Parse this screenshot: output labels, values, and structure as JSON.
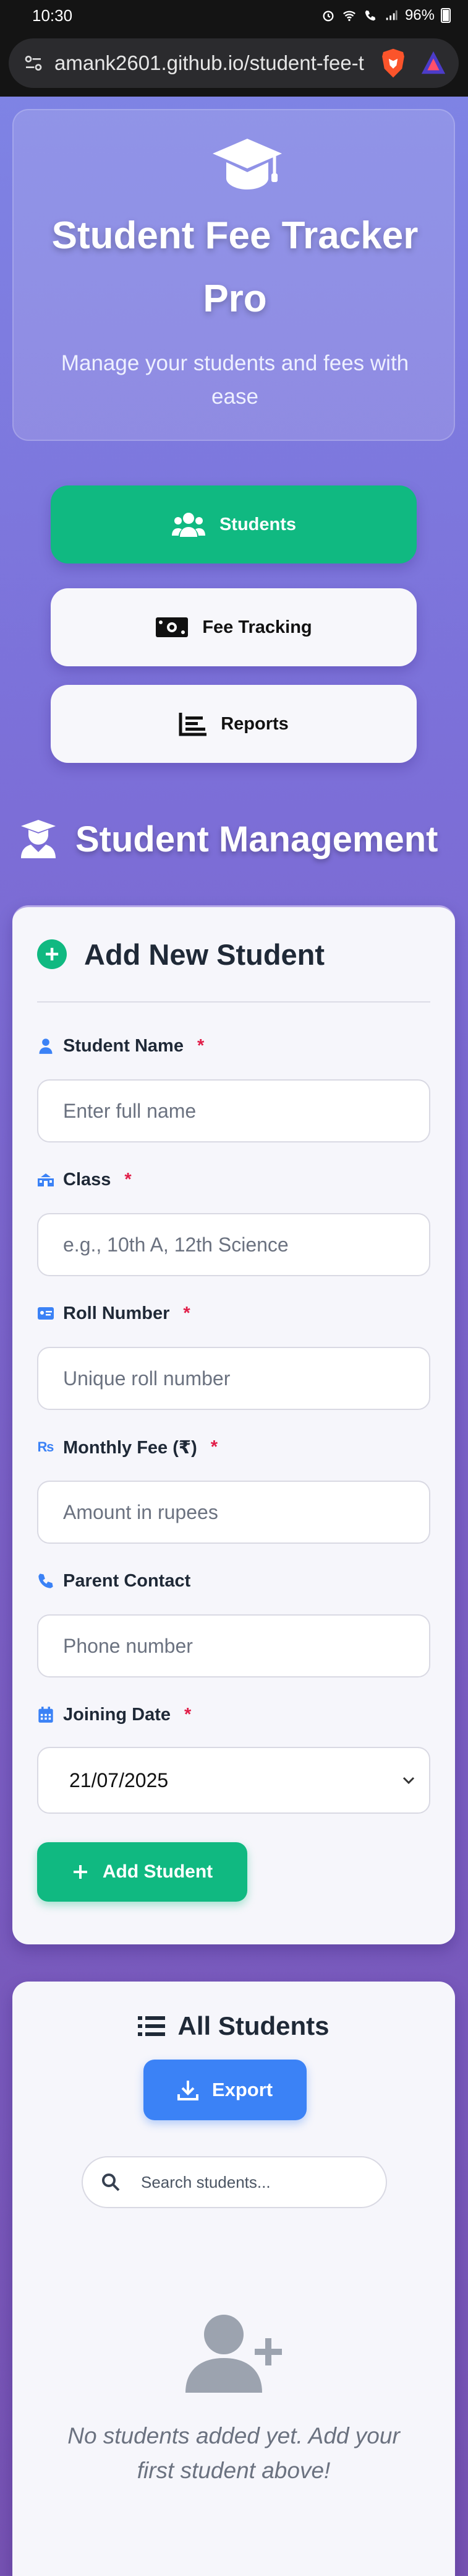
{
  "status_bar": {
    "time": "10:30",
    "battery": "96%"
  },
  "browser": {
    "url": "amank2601.github.io/student-fee-t"
  },
  "hero": {
    "title": "Student Fee Tracker Pro",
    "subtitle": "Manage your students and fees with ease"
  },
  "nav": [
    {
      "label": "Students",
      "icon": "users-icon",
      "active": true
    },
    {
      "label": "Fee Tracking",
      "icon": "money-bill-icon",
      "active": false
    },
    {
      "label": "Reports",
      "icon": "chart-bar-icon",
      "active": false
    }
  ],
  "section_title": "Student Management",
  "form": {
    "heading": "Add New Student",
    "fields": [
      {
        "label": "Student Name",
        "required": true,
        "placeholder": "Enter full name",
        "icon": "user-icon"
      },
      {
        "label": "Class",
        "required": true,
        "placeholder": "e.g., 10th A, 12th Science",
        "icon": "school-icon"
      },
      {
        "label": "Roll Number",
        "required": true,
        "placeholder": "Unique roll number",
        "icon": "id-card-icon"
      },
      {
        "label": "Monthly Fee (₹)",
        "required": true,
        "placeholder": "Amount in rupees",
        "icon": "rupee-icon"
      },
      {
        "label": "Parent Contact",
        "required": false,
        "placeholder": "Phone number",
        "icon": "phone-icon"
      },
      {
        "label": "Joining Date",
        "required": true,
        "value": "21/07/2025",
        "icon": "calendar-icon"
      }
    ],
    "submit_label": "Add Student",
    "required_mark": "*"
  },
  "list": {
    "heading": "All Students",
    "export_label": "Export",
    "search_placeholder": "Search students...",
    "empty_text": "No students added yet. Add your first student above!"
  },
  "colors": {
    "accent_green": "#10b981",
    "accent_blue": "#3b82f6",
    "required_red": "#e11d48"
  }
}
